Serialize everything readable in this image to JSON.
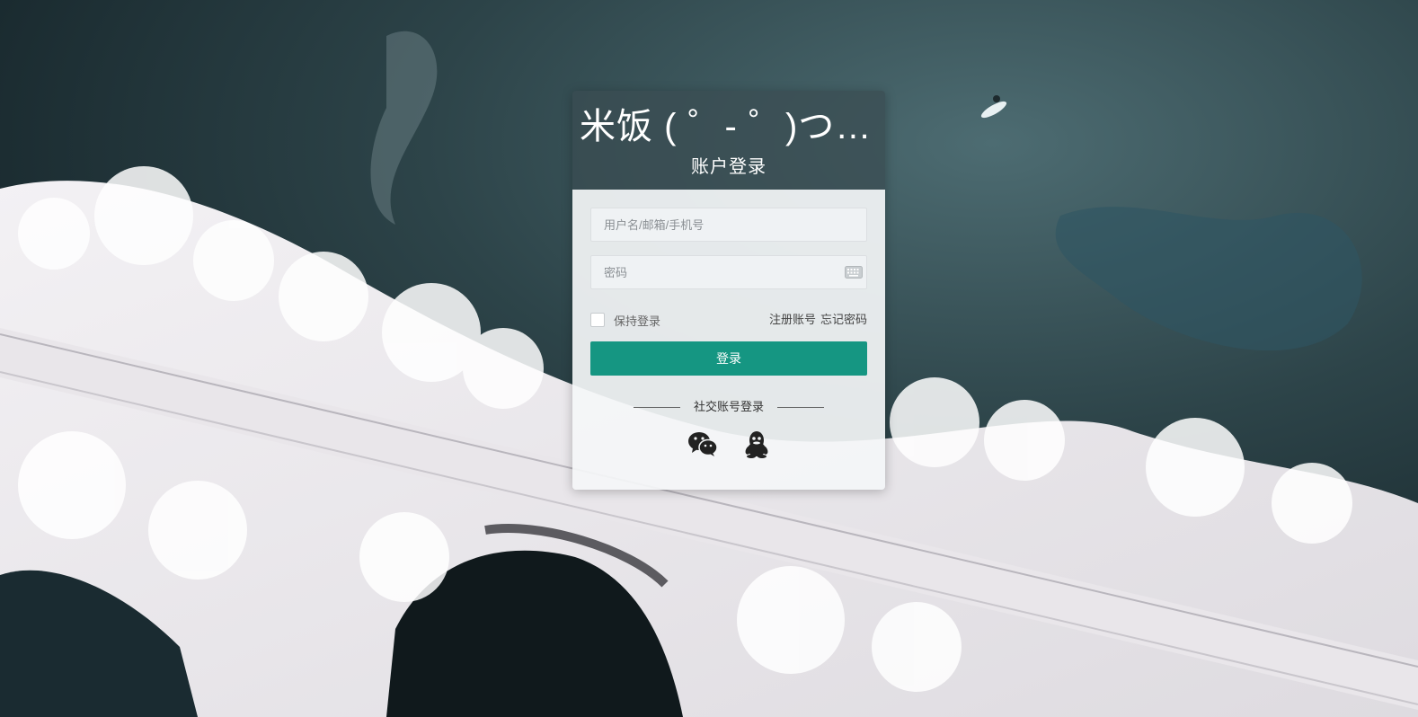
{
  "header": {
    "site_title": "米饭 ( ゜- ゜)つロ...",
    "subtitle": "账户登录"
  },
  "form": {
    "username_placeholder": "用户名/邮箱/手机号",
    "password_placeholder": "密码",
    "remember_label": "保持登录",
    "register_link": "注册账号",
    "forgot_link": "忘记密码",
    "login_button": "登录"
  },
  "social": {
    "label": "社交账号登录",
    "providers": [
      "wechat-icon",
      "qq-icon"
    ]
  },
  "colors": {
    "primary": "#159682",
    "header_overlay": "#3a4c52"
  }
}
